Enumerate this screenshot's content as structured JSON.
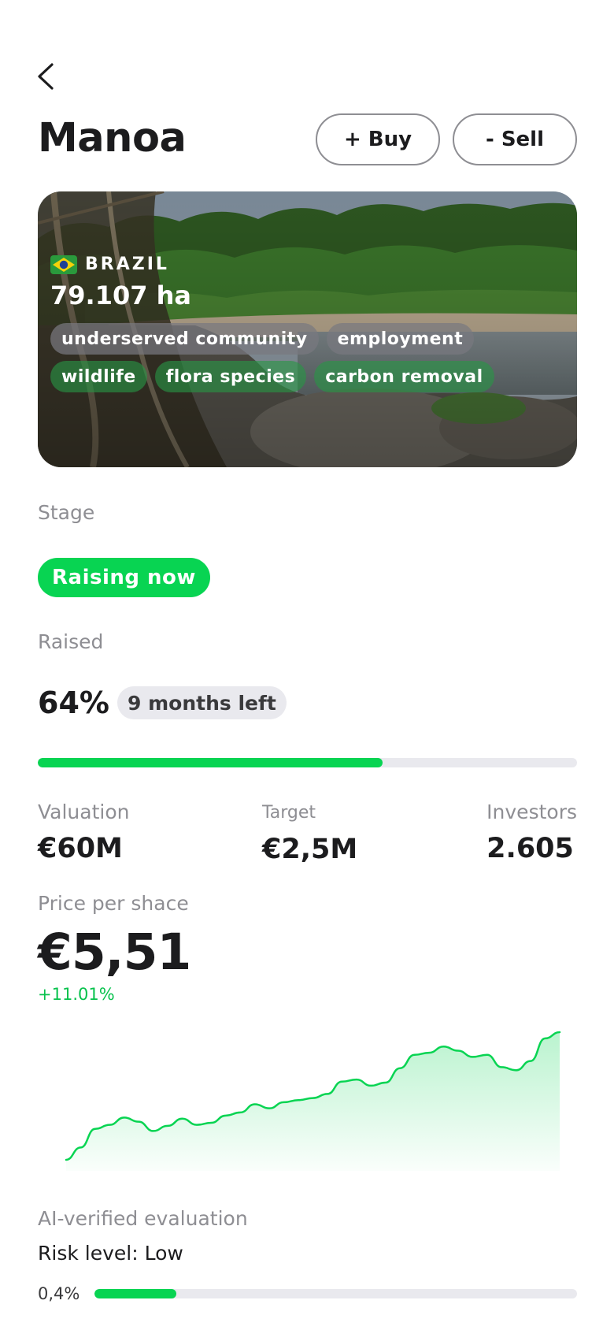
{
  "header": {
    "back_icon": "chevron-left-icon",
    "title": "Manoa",
    "buy_label": "+ Buy",
    "sell_label": "- Sell"
  },
  "hero": {
    "flag_icon": "brazil-flag-icon",
    "country": "BRAZIL",
    "area": "79.107 ha",
    "tags": [
      {
        "label": "underserved community",
        "style": "grey"
      },
      {
        "label": "employment",
        "style": "grey"
      },
      {
        "label": "wildlife",
        "style": "green"
      },
      {
        "label": "flora species",
        "style": "green"
      },
      {
        "label": "carbon removal",
        "style": "green"
      }
    ]
  },
  "stage": {
    "label": "Stage",
    "value": "Raising now"
  },
  "raised": {
    "label": "Raised",
    "percent_text": "64%",
    "progress": 0.64,
    "time_left": "9 months left"
  },
  "stats": {
    "valuation": {
      "label": "Valuation",
      "value": "€60M"
    },
    "target": {
      "label": "Target",
      "value": "€2,5M"
    },
    "investors": {
      "label": "Investors",
      "value": "2.605"
    }
  },
  "price": {
    "label": "Price per shace",
    "value": "€5,51",
    "change": "+11.01%"
  },
  "chart_data": {
    "type": "area",
    "title": "",
    "xlabel": "",
    "ylabel": "",
    "grid": false,
    "series": [
      {
        "values": [
          0,
          1.2,
          3.0,
          3.4,
          4.1,
          3.7,
          2.8,
          3.3,
          4.0,
          3.4,
          3.6,
          4.3,
          4.6,
          5.4,
          5.0,
          5.6,
          5.8,
          6.0,
          6.4,
          7.6,
          7.8,
          7.2,
          7.5,
          8.9,
          10.2,
          10.4,
          11.0,
          10.6,
          10.0,
          10.2,
          9.0,
          8.7,
          9.6,
          11.8,
          12.4
        ]
      }
    ],
    "color": "#08d452"
  },
  "evaluation": {
    "label": "AI-verified evaluation",
    "risk_text": "Risk level: Low",
    "risk_value_text": "0,4%",
    "risk_fraction": 0.17
  },
  "colors": {
    "accent": "#08d452",
    "muted_text": "#8e8e93",
    "chip_bg": "#e9e9ee"
  }
}
